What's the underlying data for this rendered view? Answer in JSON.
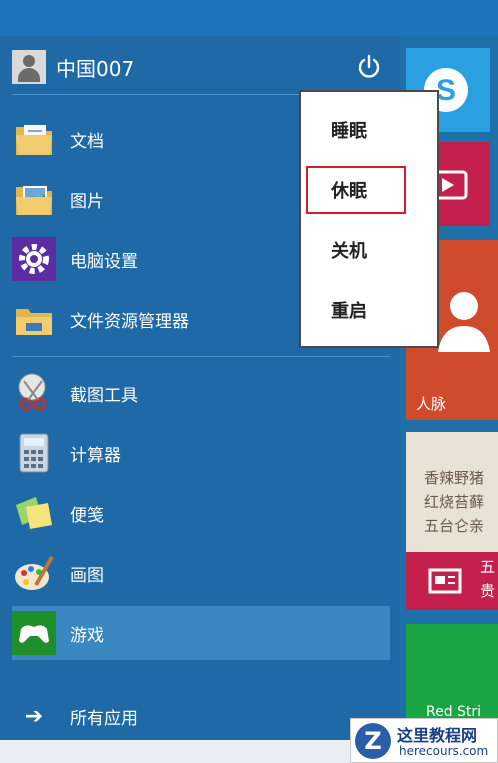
{
  "user": {
    "name": "中国007"
  },
  "menu": {
    "items": [
      {
        "label": "文档",
        "icon": "documents-folder-icon"
      },
      {
        "label": "图片",
        "icon": "pictures-folder-icon"
      },
      {
        "label": "电脑设置",
        "icon": "pc-settings-gear-icon"
      },
      {
        "label": "文件资源管理器",
        "icon": "file-explorer-icon"
      },
      {
        "label": "截图工具",
        "icon": "snipping-tool-icon"
      },
      {
        "label": "计算器",
        "icon": "calculator-icon"
      },
      {
        "label": "便笺",
        "icon": "sticky-notes-icon"
      },
      {
        "label": "画图",
        "icon": "paint-icon"
      },
      {
        "label": "游戏",
        "icon": "games-controller-icon"
      }
    ],
    "all_apps": "所有应用"
  },
  "power_menu": {
    "items": [
      "睡眠",
      "休眠",
      "关机",
      "重启"
    ],
    "highlighted": "休眠"
  },
  "tiles": {
    "people": "人脉",
    "food_lines": [
      "香辣野猪",
      "红烧苔藓",
      "五台仑亲"
    ],
    "food_news_partial": "五",
    "food_news_partial2": "贵",
    "red_tile_partial": "Red Stri"
  },
  "watermark": {
    "title": "这里教程网",
    "url": "herecours.com"
  },
  "colors": {
    "menu_bg": "#1f6aa6",
    "accent": "#3a88c2",
    "highlight": "#d0202a",
    "tile_red": "#d04a2c",
    "tile_magenta": "#c4204d",
    "tile_green": "#1aa545",
    "tile_sky": "#2aa0e0"
  }
}
